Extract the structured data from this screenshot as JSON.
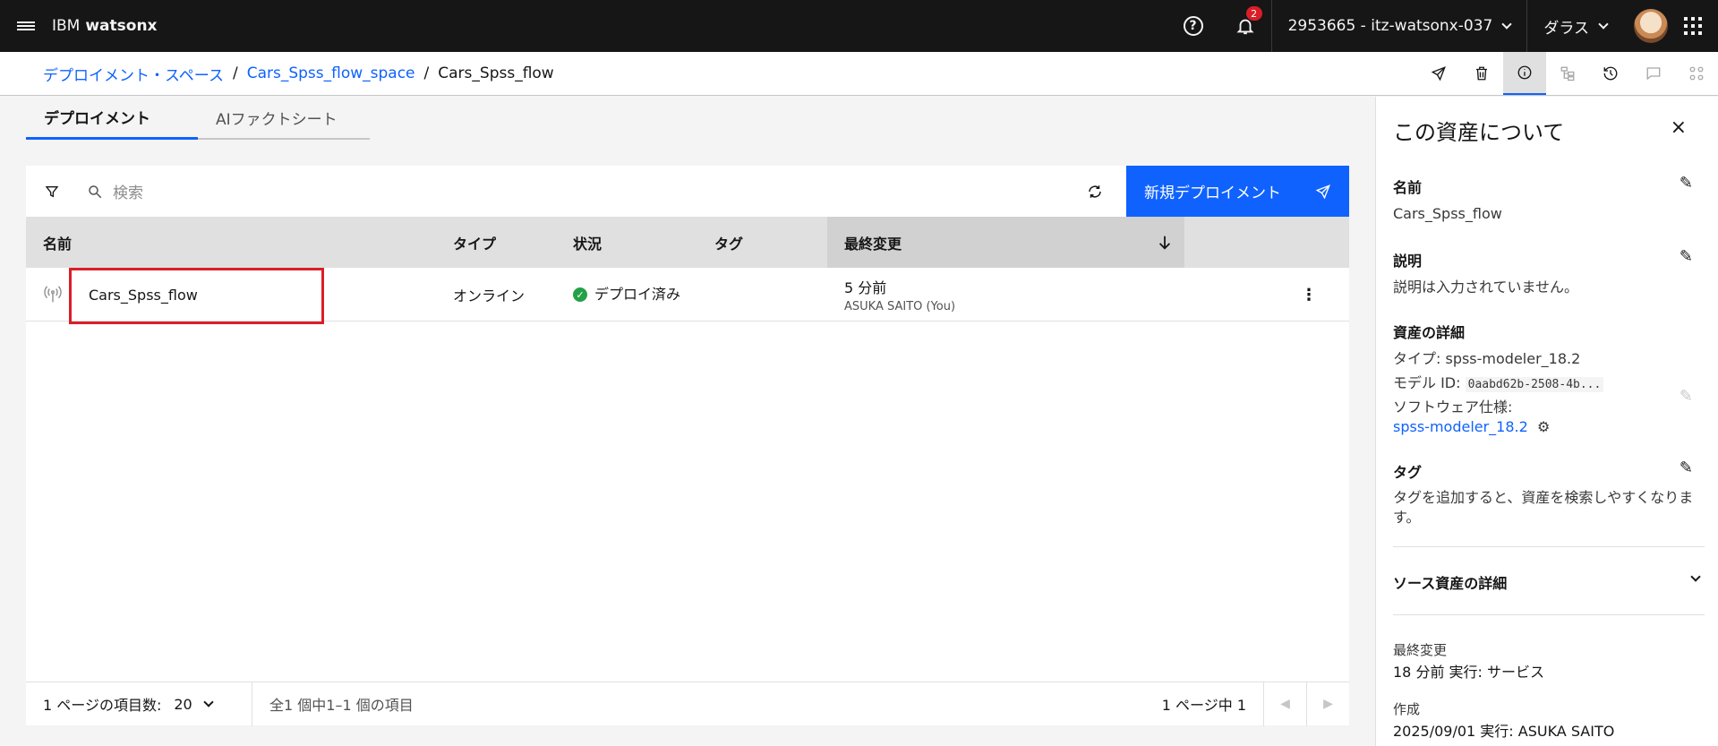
{
  "header": {
    "brand_prefix": "IBM",
    "brand_name": "watsonx",
    "notification_count": "2",
    "account": "2953665 - itz-watsonx-037",
    "region": "ダラス"
  },
  "breadcrumb": {
    "items": [
      "デプロイメント・スペース",
      "Cars_Spss_flow_space",
      "Cars_Spss_flow"
    ]
  },
  "tabs": [
    "デプロイメント",
    "AIファクトシート"
  ],
  "table": {
    "search_placeholder": "検索",
    "new_button": "新規デプロイメント",
    "columns": [
      "名前",
      "タイプ",
      "状況",
      "タグ",
      "最終変更"
    ],
    "rows": [
      {
        "name": "Cars_Spss_flow",
        "type": "オンライン",
        "status": "デプロイ済み",
        "tag": "",
        "modified": "5 分前",
        "modified_by": "ASUKA SAITO (You)"
      }
    ],
    "footer": {
      "per_page_label": "1 ページの項目数:",
      "per_page_value": "20",
      "range": "全1 個中1–1 個の項目",
      "page": "1 ページ中 1"
    }
  },
  "panel": {
    "title": "この資産について",
    "name_label": "名前",
    "name_value": "Cars_Spss_flow",
    "desc_label": "説明",
    "desc_value": "説明は入力されていません。",
    "details_label": "資産の詳細",
    "type_line": "タイプ: spss-modeler_18.2",
    "model_id_label": "モデル ID:",
    "model_id_value": "0aabd62b-2508-4b...",
    "software_label": "ソフトウェア仕様:",
    "software_value": "spss-modeler_18.2",
    "tags_label": "タグ",
    "tags_hint": "タグを追加すると、資産を検索しやすくなります。",
    "source_label": "ソース資産の詳細",
    "modified_label": "最終変更",
    "modified_value": "18 分前 実行: サービス",
    "created_label": "作成",
    "created_value": "2025/09/01 実行: ASUKA SAITO"
  },
  "colors": {
    "primary": "#0f62fe",
    "header_bg": "#161616",
    "success": "#24a148",
    "alert": "#da1e28"
  }
}
